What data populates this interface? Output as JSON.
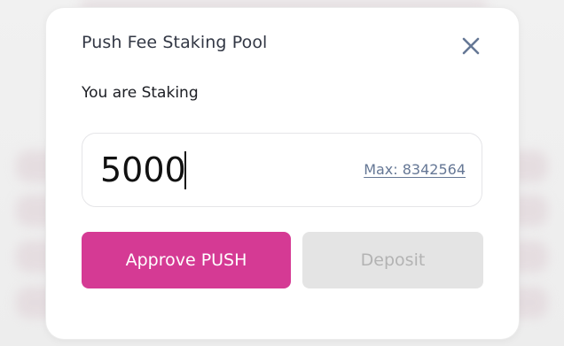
{
  "modal": {
    "title": "Push Fee Staking Pool",
    "close_icon": "close-icon",
    "subtitle": "You are Staking",
    "amount_value": "5000",
    "max_label": "Max: 8342564",
    "approve_label": "Approve PUSH",
    "deposit_label": "Deposit"
  },
  "colors": {
    "accent": "#D53A94",
    "disabled_bg": "#E4E4E4",
    "disabled_text": "#B3B3B3",
    "link": "#657795"
  }
}
